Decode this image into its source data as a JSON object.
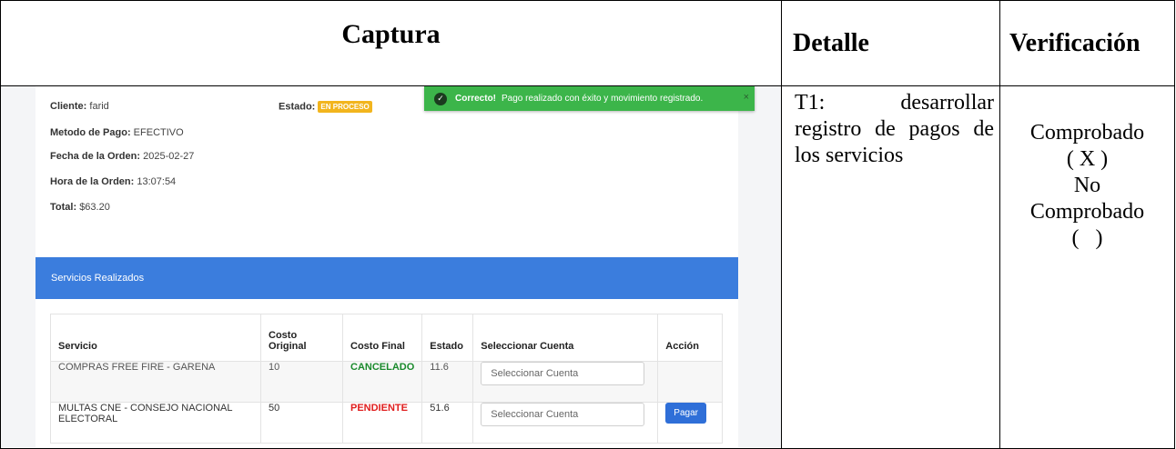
{
  "headers": {
    "capture": "Captura",
    "detail": "Detalle",
    "verification": "Verificación"
  },
  "screenshot": {
    "toast": {
      "title": "Correcto!",
      "message": "Pago realizado con éxito y movimiento registrado.",
      "close": "×",
      "color": "#3cb54a"
    },
    "order": {
      "client_label": "Cliente:",
      "client_value": "farid",
      "status_label": "Estado:",
      "status_badge": "EN PROCESO",
      "payment_label": "Metodo de Pago:",
      "payment_value": "EFECTIVO",
      "date_label": "Fecha de la Orden:",
      "date_value": "2025-02-27",
      "time_label": "Hora de la Orden:",
      "time_value": "13:07:54",
      "total_label": "Total:",
      "total_value": "$63.20"
    },
    "services_panel": {
      "title": "Servicios Realizados",
      "header_color": "#3b7ddd",
      "columns": [
        "Servicio",
        "Costo Original",
        "Costo Final",
        "Estado",
        "Seleccionar Cuenta",
        "Acción"
      ],
      "rows": [
        {
          "service": "COMPRAS FREE FIRE - GARENA",
          "original": "10",
          "final": "CANCELADO",
          "status": "11.6",
          "account_placeholder": "Seleccionar Cuenta",
          "action": ""
        },
        {
          "service": "MULTAS CNE - CONSEJO NACIONAL ELECTORAL",
          "original": "50",
          "final": "PENDIENTE",
          "status": "51.6",
          "account_placeholder": "Seleccionar Cuenta",
          "action": "Pagar"
        }
      ]
    }
  },
  "detail_text": "T1: desarrollar registro de pagos de los servicios",
  "verification": {
    "checked_label": "Comprobado",
    "checked_mark": "( X )",
    "unchecked_line1": "No",
    "unchecked_line2": "Comprobado",
    "unchecked_mark": "(   )"
  }
}
